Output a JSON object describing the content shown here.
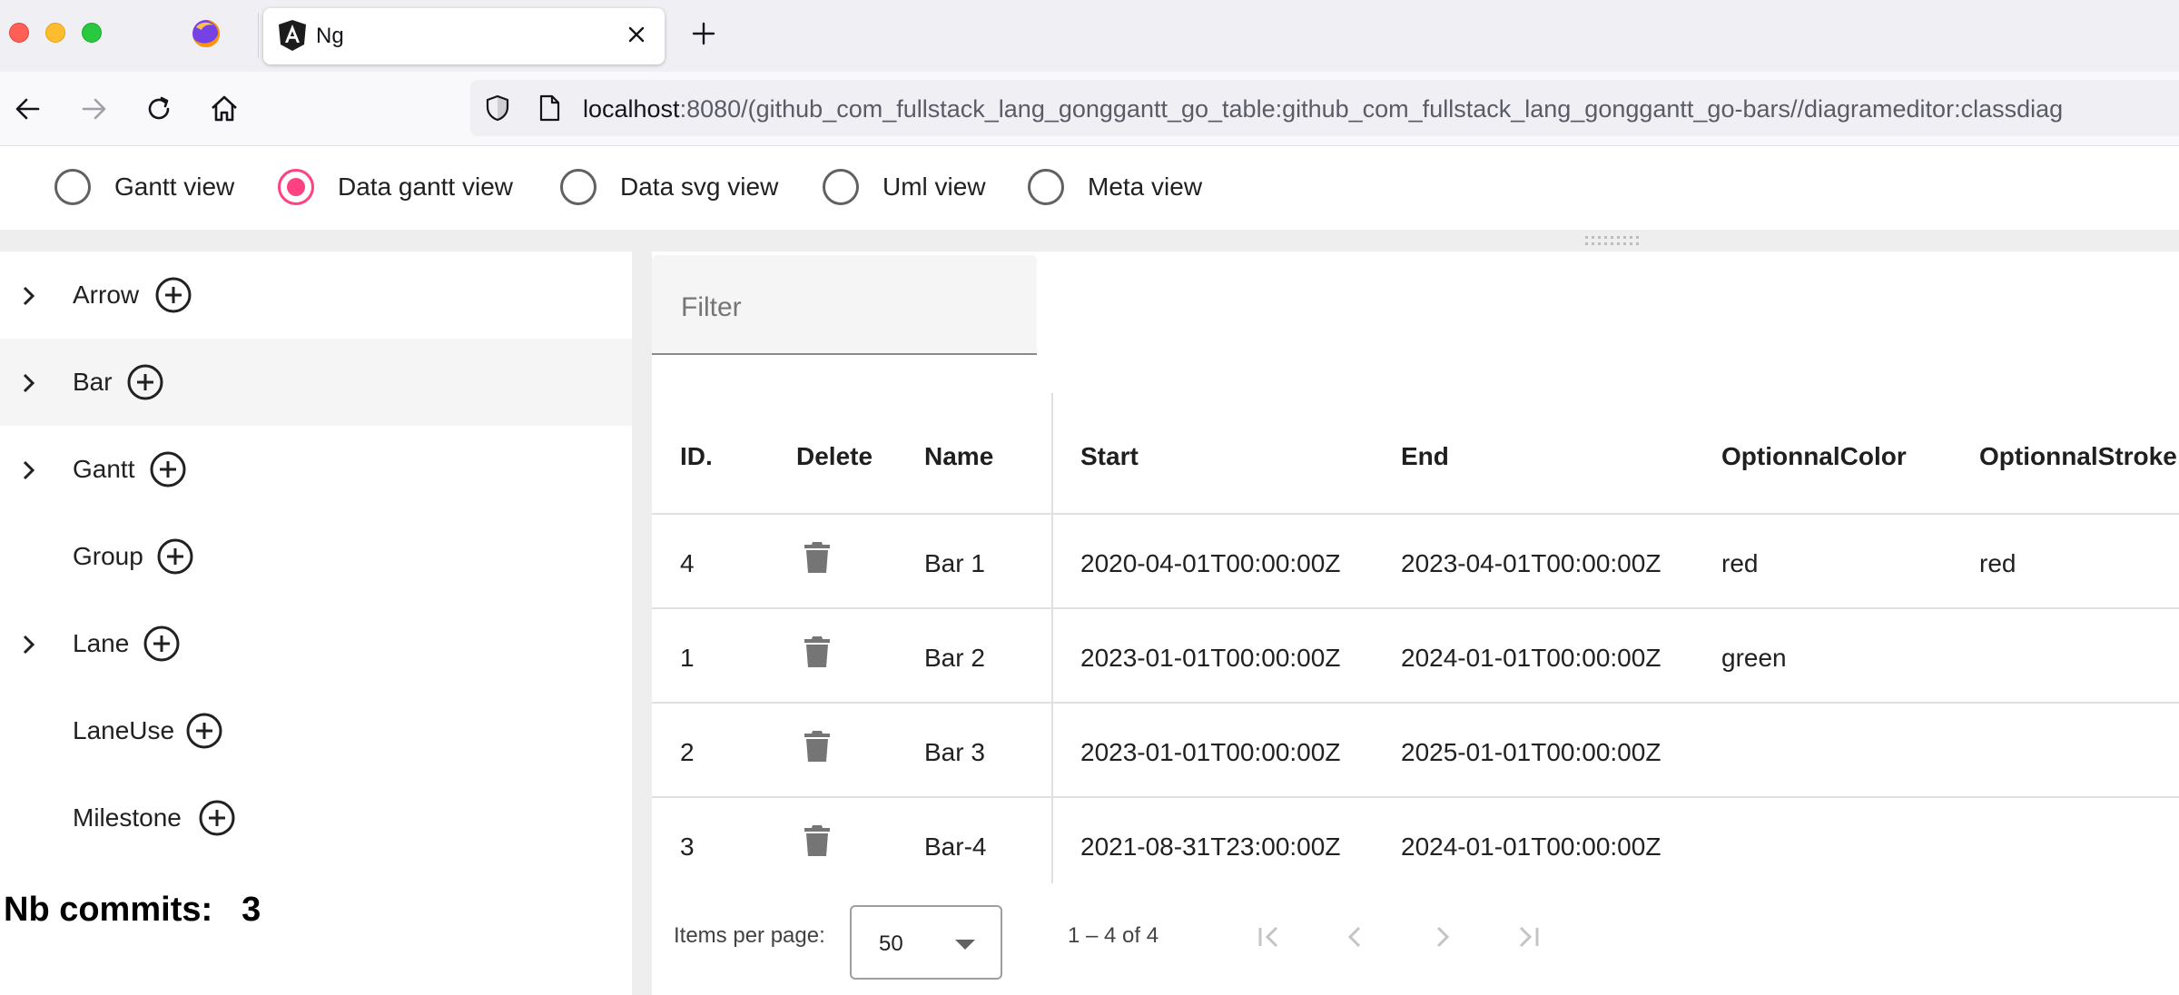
{
  "browser": {
    "tab_title": "Ng",
    "url_host": "localhost",
    "url_rest": ":8080/(github_com_fullstack_lang_gonggantt_go_table:github_com_fullstack_lang_gonggantt_go-bars//diagrameditor:classdiag"
  },
  "views": [
    {
      "label": "Gantt view",
      "checked": false
    },
    {
      "label": "Data gantt view",
      "checked": true
    },
    {
      "label": "Data svg view",
      "checked": false
    },
    {
      "label": "Uml view",
      "checked": false
    },
    {
      "label": "Meta view",
      "checked": false
    }
  ],
  "tree": [
    {
      "label": "Arrow",
      "expandable": true
    },
    {
      "label": "Bar",
      "expandable": true
    },
    {
      "label": "Gantt",
      "expandable": true
    },
    {
      "label": "Group",
      "expandable": false
    },
    {
      "label": "Lane",
      "expandable": true
    },
    {
      "label": "LaneUse",
      "expandable": false
    },
    {
      "label": "Milestone",
      "expandable": false
    }
  ],
  "commits": {
    "label": "Nb commits:",
    "value": "3"
  },
  "filter": {
    "placeholder": "Filter"
  },
  "table": {
    "columns": [
      "ID.",
      "Delete",
      "Name",
      "Start",
      "End",
      "OptionnalColor",
      "OptionnalStroke"
    ],
    "rows": [
      {
        "id": "4",
        "name": "Bar 1",
        "start": "2020-04-01T00:00:00Z",
        "end": "2023-04-01T00:00:00Z",
        "color": "red",
        "stroke": "red"
      },
      {
        "id": "1",
        "name": "Bar 2",
        "start": "2023-01-01T00:00:00Z",
        "end": "2024-01-01T00:00:00Z",
        "color": "green",
        "stroke": ""
      },
      {
        "id": "2",
        "name": "Bar 3",
        "start": "2023-01-01T00:00:00Z",
        "end": "2025-01-01T00:00:00Z",
        "color": "",
        "stroke": ""
      },
      {
        "id": "3",
        "name": "Bar-4",
        "start": "2021-08-31T23:00:00Z",
        "end": "2024-01-01T00:00:00Z",
        "color": "",
        "stroke": ""
      }
    ]
  },
  "paginator": {
    "items_per_page_label": "Items per page:",
    "items_per_page": "50",
    "range": "1 – 4 of 4"
  },
  "icons": {
    "tab_close": "close-icon",
    "trash": "delete-icon",
    "add": "add-circle-icon",
    "chevron": "chevron-right-icon"
  },
  "colors": {
    "accent": "#ff4081"
  }
}
